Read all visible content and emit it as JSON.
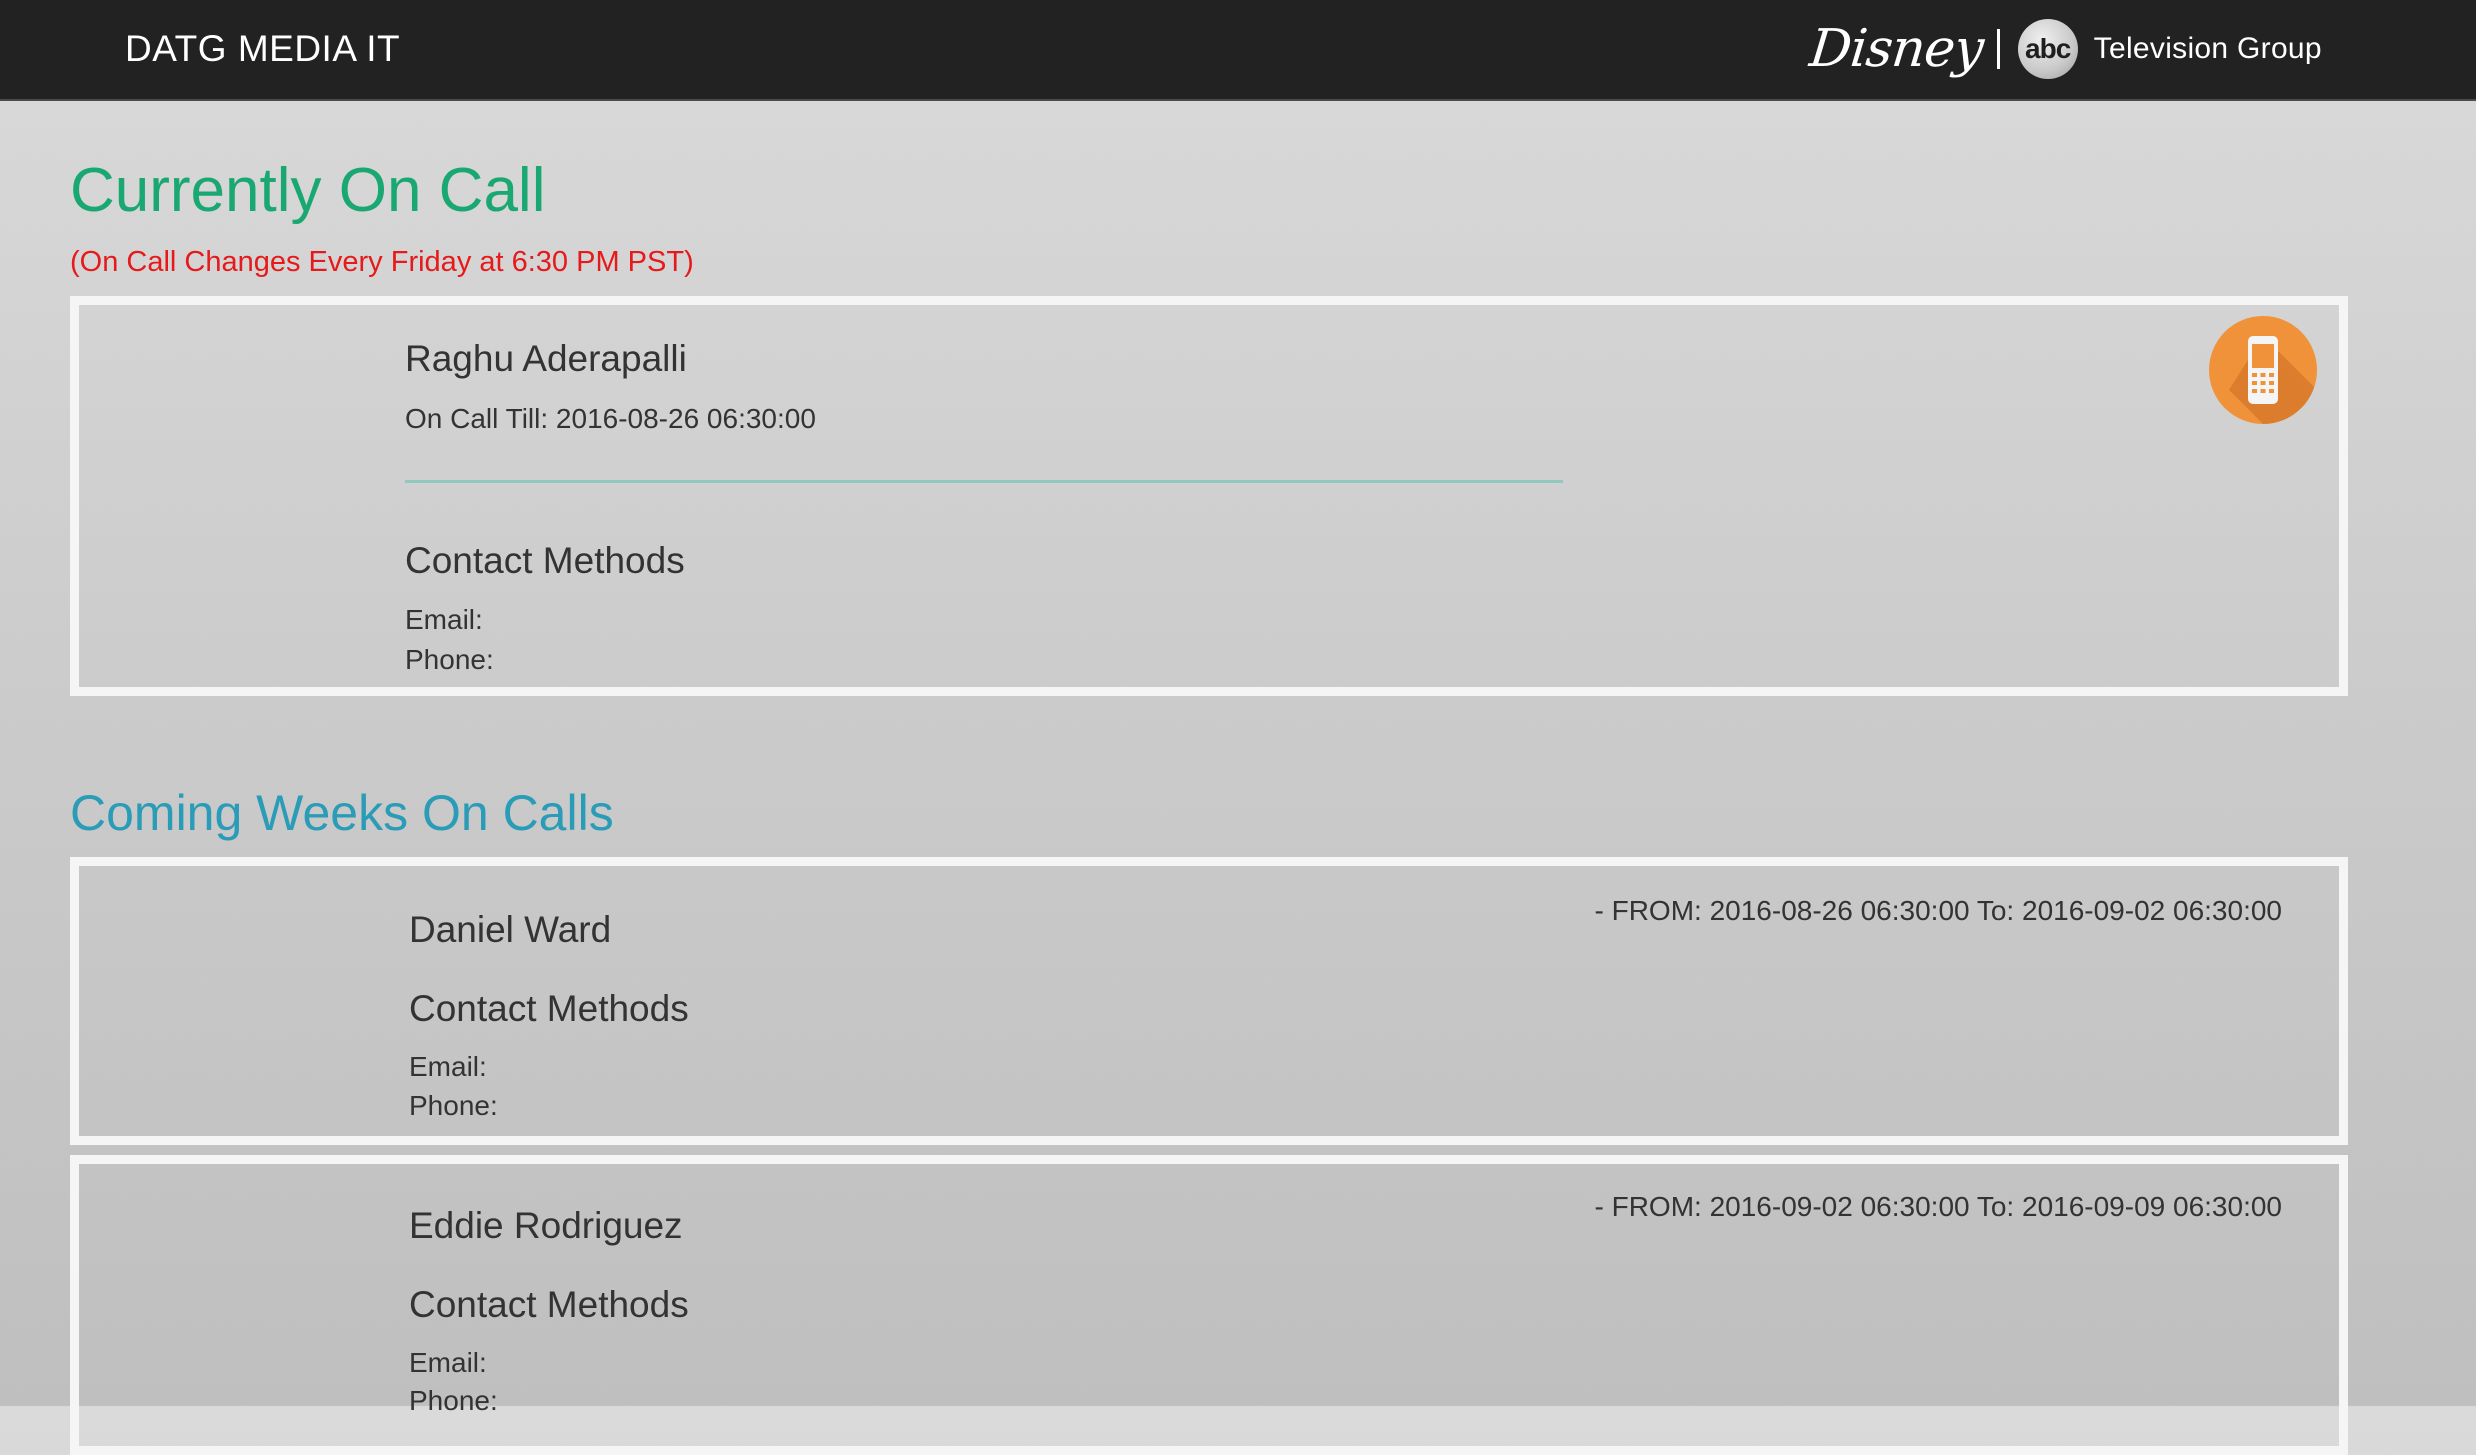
{
  "header": {
    "brand": "DATG MEDIA IT",
    "logo": {
      "disney": "Disney",
      "abc": "abc",
      "group": "Television Group"
    }
  },
  "current": {
    "title": "Currently On Call",
    "note": "(On Call Changes Every Friday at 6:30 PM PST)",
    "person": {
      "name": "Raghu Aderapalli",
      "on_call_till": "On Call Till: 2016-08-26 06:30:00",
      "contact_heading": "Contact Methods",
      "email_label": "Email:",
      "phone_label": "Phone:",
      "badge_icon": "mobile-phone-icon"
    }
  },
  "coming": {
    "title": "Coming Weeks On Calls",
    "weeks": [
      {
        "name": "Daniel Ward",
        "range": "- FROM: 2016-08-26 06:30:00 To: 2016-09-02 06:30:00",
        "contact_heading": "Contact Methods",
        "email_label": "Email:",
        "phone_label": "Phone:"
      },
      {
        "name": "Eddie Rodriguez",
        "range": "- FROM: 2016-09-02 06:30:00 To: 2016-09-09 06:30:00",
        "contact_heading": "Contact Methods",
        "email_label": "Email:",
        "phone_label": "Phone:"
      }
    ]
  },
  "colors": {
    "header_bg": "#222222",
    "current_title": "#1aa872",
    "note": "#e61a1a",
    "coming_title": "#2a9cb7",
    "badge": "#f0923a",
    "divider": "#8fc9bd"
  }
}
